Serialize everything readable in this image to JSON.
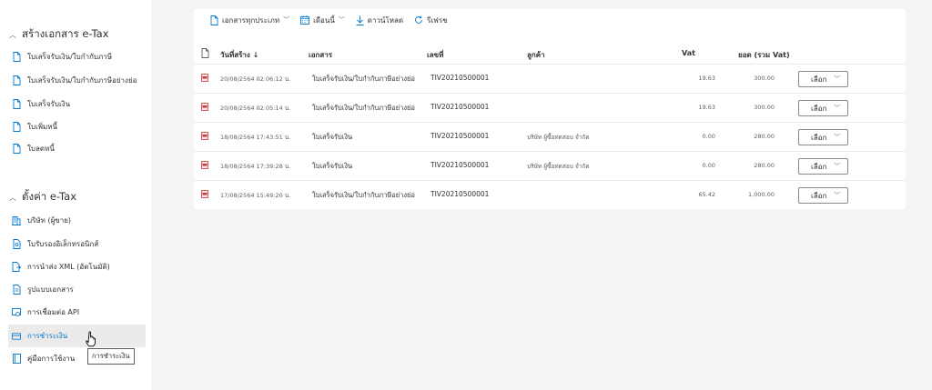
{
  "sidebar": {
    "section1": {
      "title": "สร้างเอกสาร e-Tax"
    },
    "create_items": [
      {
        "label": "ใบเสร็จรับเงิน/ใบกำกับภาษี"
      },
      {
        "label": "ใบเสร็จรับเงิน/ใบกำกับภาษีอย่างย่อ"
      },
      {
        "label": "ใบเสร็จรับเงิน"
      },
      {
        "label": "ใบเพิ่มหนี้"
      },
      {
        "label": "ใบลดหนี้"
      }
    ],
    "section2": {
      "title": "ตั้งค่า e-Tax"
    },
    "settings_items": [
      {
        "label": "บริษัท (ผู้ขาย)"
      },
      {
        "label": "ใบรับรองอิเล็กทรอนิกส์"
      },
      {
        "label": "การนำส่ง XML (อัตโนมัติ)"
      },
      {
        "label": "รูปแบบเอกสาร"
      },
      {
        "label": "การเชื่อมต่อ API"
      },
      {
        "label": "การชำระเงิน"
      },
      {
        "label": "คู่มือการใช้งาน"
      }
    ],
    "tooltip": "การชำระเงิน"
  },
  "toolbar": {
    "doc_type": "เอกสารทุกประเภท",
    "month": "เดือนนี้",
    "download": "ดาวน์โหลด",
    "refresh": "รีเฟรช"
  },
  "table": {
    "headers": {
      "created": "วันที่สร้าง ↓",
      "document": "เอกสาร",
      "number": "เลขที่",
      "customer": "ลูกค้า",
      "vat": "Vat",
      "total": "ยอด (รวม Vat)"
    },
    "select_label": "เลือก",
    "rows": [
      {
        "created": "20/08/2564 02:06:12 น.",
        "document": "ใบเสร็จรับเงิน/ใบกำกับภาษีอย่างย่อ",
        "number": "TIV20210500001",
        "customer": "",
        "vat": "19.63",
        "total": "300.00"
      },
      {
        "created": "20/08/2564 02:05:14 น.",
        "document": "ใบเสร็จรับเงิน/ใบกำกับภาษีอย่างย่อ",
        "number": "TIV20210500001",
        "customer": "",
        "vat": "19.63",
        "total": "300.00"
      },
      {
        "created": "18/08/2564 17:43:51 น.",
        "document": "ใบเสร็จรับเงิน",
        "number": "TIV20210500001",
        "customer": "บริษัท ผู้ซื้อทดสอบ จำกัด",
        "vat": "0.00",
        "total": "280.00"
      },
      {
        "created": "18/08/2564 17:39:28 น.",
        "document": "ใบเสร็จรับเงิน",
        "number": "TIV20210500001",
        "customer": "บริษัท ผู้ซื้อทดสอบ จำกัด",
        "vat": "0.00",
        "total": "280.00"
      },
      {
        "created": "17/08/2564 15:49:20 น.",
        "document": "ใบเสร็จรับเงิน/ใบกำกับภาษีอย่างย่อ",
        "number": "TIV20210500001",
        "customer": "",
        "vat": "65.42",
        "total": "1,000.00"
      }
    ]
  },
  "colors": {
    "accent": "#0078d4",
    "pdf": "#d13438",
    "border": "#edebe9"
  }
}
